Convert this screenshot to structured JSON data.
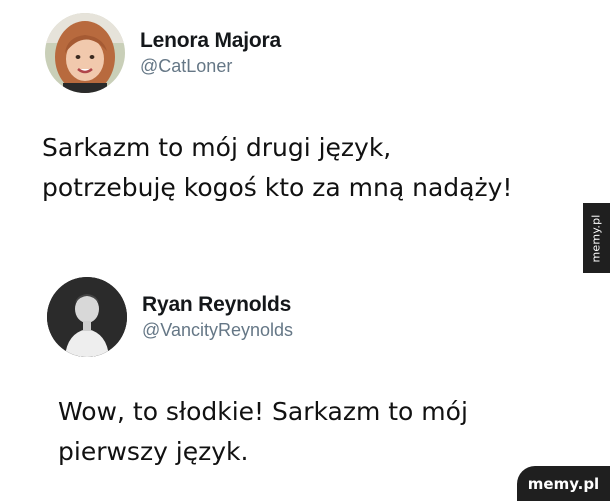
{
  "tweets": [
    {
      "name": "Lenora Majora",
      "handle": "@CatLoner",
      "text": "Sarkazm to mój drugi język,\npotrzebuję kogoś kto za mną nadąży!"
    },
    {
      "name": "Ryan Reynolds",
      "handle": "@VancityReynolds",
      "text": "Wow, to słodkie! Sarkazm to mój\npierwszy język."
    }
  ],
  "side_tab": "memy.pl",
  "watermark": "memy.pl"
}
